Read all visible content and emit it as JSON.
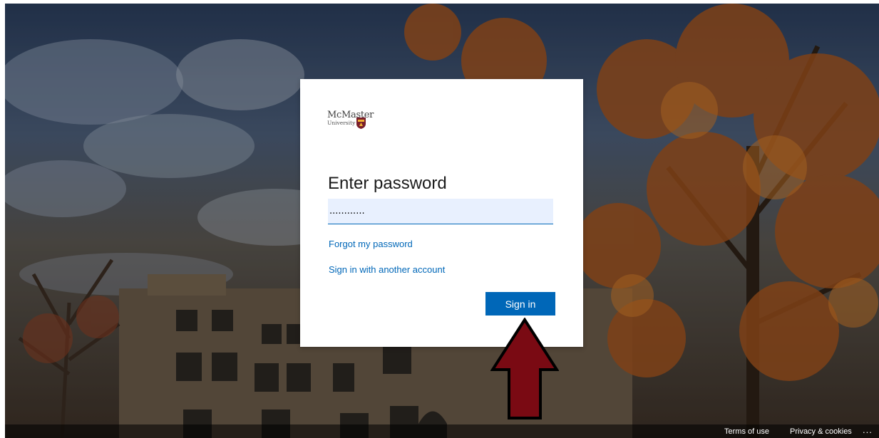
{
  "brand": {
    "name": "McMaster",
    "sub": "University"
  },
  "login": {
    "title": "Enter password",
    "password_value": "............",
    "forgot_link": "Forgot my password",
    "other_account_link": "Sign in with another account",
    "sign_in_button": "Sign in"
  },
  "footer": {
    "terms": "Terms of use",
    "privacy": "Privacy & cookies",
    "more": "..."
  },
  "colors": {
    "accent": "#0067b8",
    "arrow": "#7a0a13",
    "input_bg": "#e8f0fe"
  }
}
